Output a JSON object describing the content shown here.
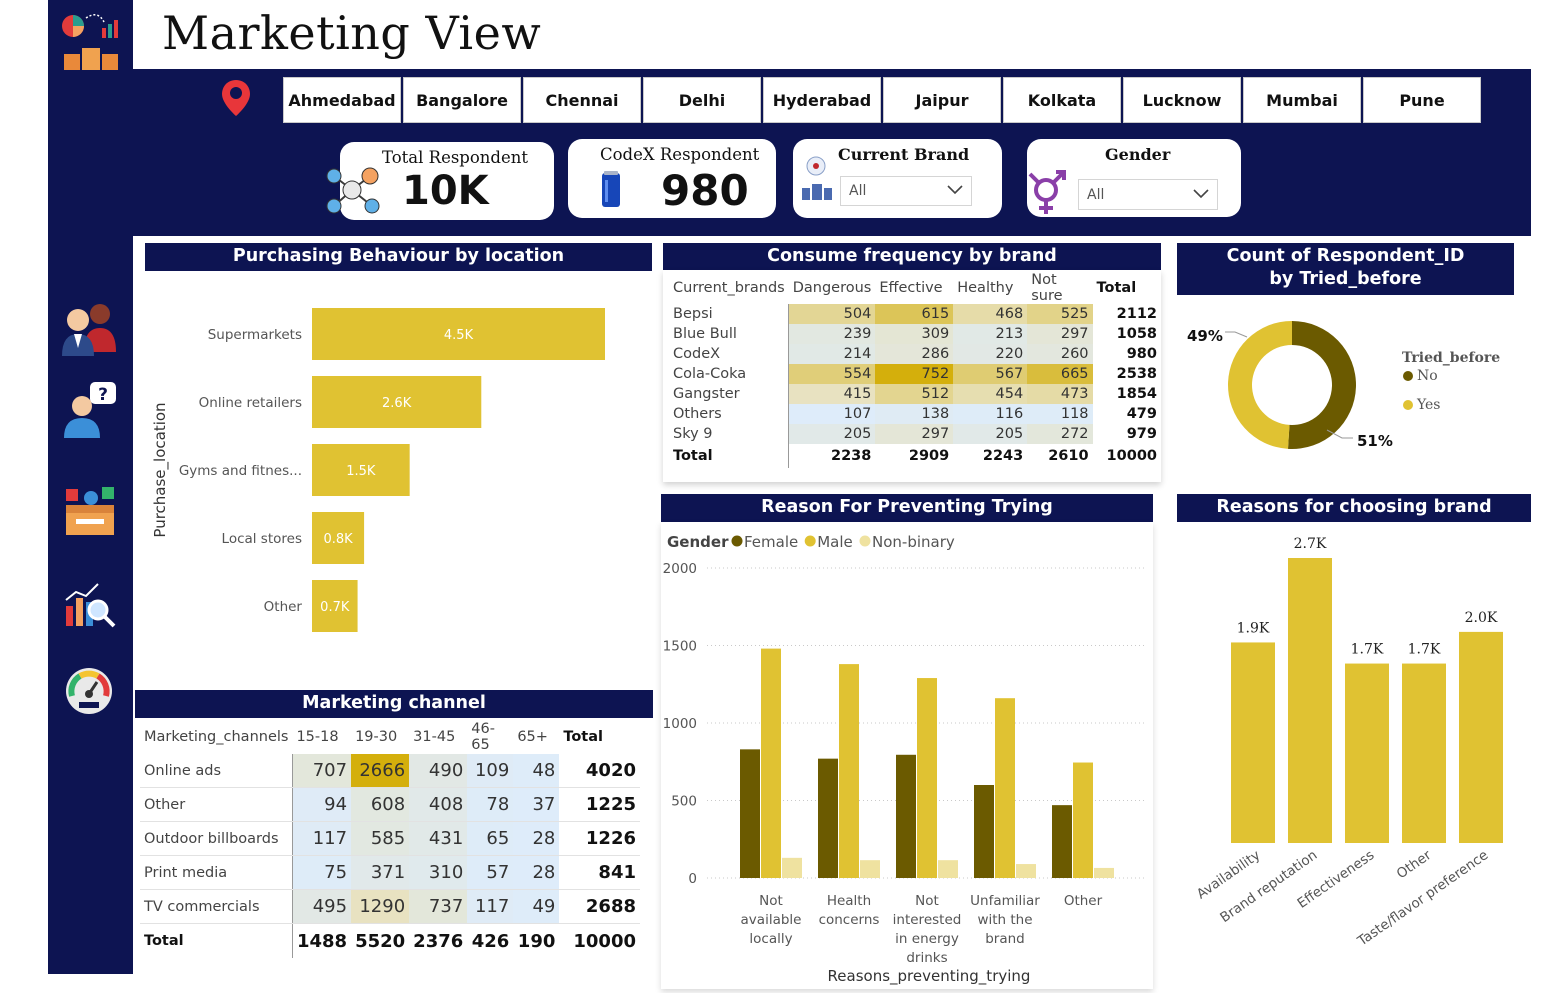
{
  "page": {
    "title": "Marketing View"
  },
  "cities": [
    "Ahmedabad",
    "Bangalore",
    "Chennai",
    "Delhi",
    "Hyderabad",
    "Jaipur",
    "Kolkata",
    "Lucknow",
    "Mumbai",
    "Pune"
  ],
  "kpis": {
    "total_respondent": {
      "label": "Total Respondent",
      "value": "10K"
    },
    "codex_respondent": {
      "label": "CodeX Respondent",
      "value": "980"
    }
  },
  "slicers": {
    "current_brand": {
      "label": "Current Brand",
      "value": "All"
    },
    "gender": {
      "label": "Gender",
      "value": "All"
    }
  },
  "colors": {
    "navy": "#0d1452",
    "gold": "#e0c232",
    "olive": "#6b5a00",
    "pale": "#efe2a0"
  },
  "purchasing": {
    "title": "Purchasing Behaviour by location",
    "ylabel": "Purchase_location",
    "chart_data": {
      "type": "bar",
      "orientation": "horizontal",
      "categories": [
        "Supermarkets",
        "Online retailers",
        "Gyms and fitnes...",
        "Local stores",
        "Other"
      ],
      "values": [
        4.5,
        2.6,
        1.5,
        0.8,
        0.7
      ],
      "labels": [
        "4.5K",
        "2.6K",
        "1.5K",
        "0.8K",
        "0.7K"
      ],
      "unit": "K"
    }
  },
  "consume": {
    "title": "Consume frequency by brand",
    "headers": [
      "Current_brands",
      "Dangerous",
      "Effective",
      "Healthy",
      "Not sure",
      "Total"
    ],
    "rows": [
      [
        "Bepsi",
        "504",
        "615",
        "468",
        "525",
        "2112"
      ],
      [
        "Blue Bull",
        "239",
        "309",
        "213",
        "297",
        "1058"
      ],
      [
        "CodeX",
        "214",
        "286",
        "220",
        "260",
        "980"
      ],
      [
        "Cola-Coka",
        "554",
        "752",
        "567",
        "665",
        "2538"
      ],
      [
        "Gangster",
        "415",
        "512",
        "454",
        "473",
        "1854"
      ],
      [
        "Others",
        "107",
        "138",
        "116",
        "118",
        "479"
      ],
      [
        "Sky 9",
        "205",
        "297",
        "205",
        "272",
        "979"
      ]
    ],
    "total": [
      "Total",
      "2238",
      "2909",
      "2243",
      "2610",
      "10000"
    ]
  },
  "donut": {
    "title": "Count of Respondent_ID by Tried_before",
    "legend_title": "Tried_before",
    "chart_data": {
      "type": "pie",
      "categories": [
        "No",
        "Yes"
      ],
      "values": [
        51,
        49
      ],
      "labels": [
        "51%",
        "49%"
      ],
      "colors": [
        "#6b5a00",
        "#e0c232"
      ]
    }
  },
  "marketing": {
    "title": "Marketing channel",
    "headers": [
      "Marketing_channels",
      "15-18",
      "19-30",
      "31-45",
      "46-65",
      "65+",
      "Total"
    ],
    "rows": [
      [
        "Online ads",
        "707",
        "2666",
        "490",
        "109",
        "48",
        "4020"
      ],
      [
        "Other",
        "94",
        "608",
        "408",
        "78",
        "37",
        "1225"
      ],
      [
        "Outdoor billboards",
        "117",
        "585",
        "431",
        "65",
        "28",
        "1226"
      ],
      [
        "Print media",
        "75",
        "371",
        "310",
        "57",
        "28",
        "841"
      ],
      [
        "TV commercials",
        "495",
        "1290",
        "737",
        "117",
        "49",
        "2688"
      ]
    ],
    "total": [
      "Total",
      "1488",
      "5520",
      "2376",
      "426",
      "190",
      "10000"
    ]
  },
  "preventing": {
    "title": "Reason For Preventing Trying",
    "legend_title": "Gender",
    "xlabel": "Reasons_preventing_trying",
    "chart_data": {
      "type": "bar",
      "categories": [
        [
          "Not",
          "available",
          "locally"
        ],
        [
          "Health",
          "concerns"
        ],
        [
          "Not",
          "interested",
          "in energy",
          "drinks"
        ],
        [
          "Unfamiliar",
          "with the",
          "brand"
        ],
        [
          "Other"
        ]
      ],
      "series": [
        {
          "name": "Female",
          "values": [
            830,
            770,
            795,
            600,
            470
          ],
          "color": "#6b5a00"
        },
        {
          "name": "Male",
          "values": [
            1480,
            1380,
            1290,
            1160,
            745
          ],
          "color": "#e0c232"
        },
        {
          "name": "Non-binary",
          "values": [
            130,
            115,
            115,
            90,
            65
          ],
          "color": "#efe2a0"
        }
      ],
      "yticks": [
        "0",
        "500",
        "1000",
        "1500",
        "2000"
      ],
      "ylim": [
        0,
        2000
      ]
    }
  },
  "choosing": {
    "title": "Reasons for choosing brand",
    "chart_data": {
      "type": "bar",
      "categories": [
        "Availability",
        "Brand reputation",
        "Effectiveness",
        "Other",
        "Taste/flavor preference"
      ],
      "values": [
        1.9,
        2.7,
        1.7,
        1.7,
        2.0
      ],
      "labels": [
        "1.9K",
        "2.7K",
        "1.7K",
        "1.7K",
        "2.0K"
      ],
      "unit": "K"
    }
  },
  "nav": [
    "people-icon",
    "question-person-icon",
    "voting-box-icon",
    "analytics-icon",
    "gauge-icon"
  ]
}
